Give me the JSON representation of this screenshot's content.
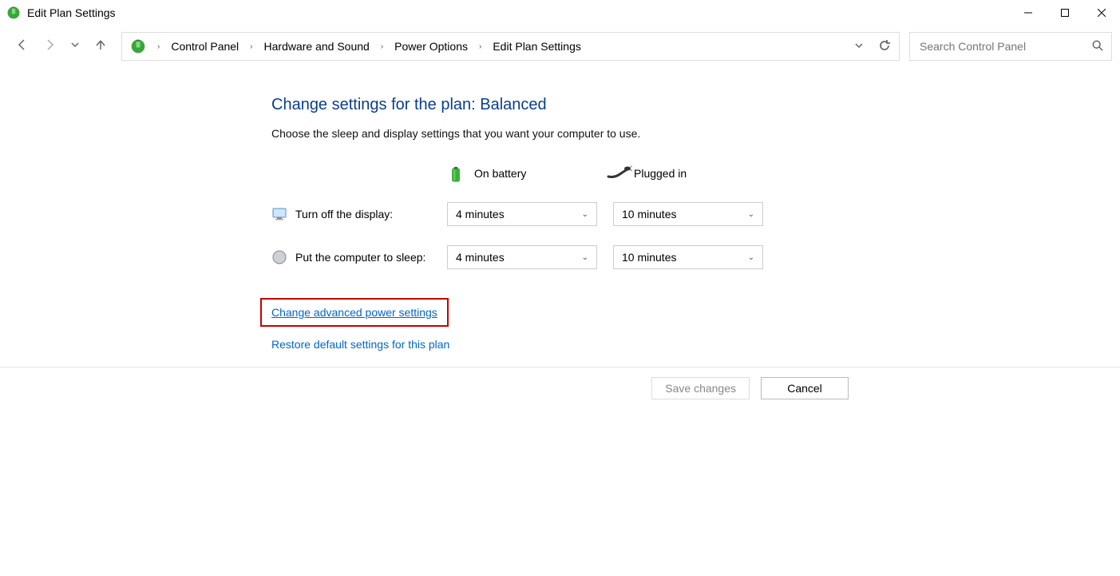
{
  "window": {
    "title": "Edit Plan Settings"
  },
  "breadcrumb": {
    "items": [
      "Control Panel",
      "Hardware and Sound",
      "Power Options",
      "Edit Plan Settings"
    ]
  },
  "search": {
    "placeholder": "Search Control Panel"
  },
  "main": {
    "heading": "Change settings for the plan: Balanced",
    "subtext": "Choose the sleep and display settings that you want your computer to use.",
    "columns": {
      "battery": "On battery",
      "plugged": "Plugged in"
    },
    "rows": {
      "display": {
        "label": "Turn off the display:",
        "battery": "4 minutes",
        "plugged": "10 minutes"
      },
      "sleep": {
        "label": "Put the computer to sleep:",
        "battery": "4 minutes",
        "plugged": "10 minutes"
      }
    },
    "links": {
      "advanced": "Change advanced power settings",
      "restore": "Restore default settings for this plan"
    }
  },
  "footer": {
    "save": "Save changes",
    "cancel": "Cancel"
  }
}
